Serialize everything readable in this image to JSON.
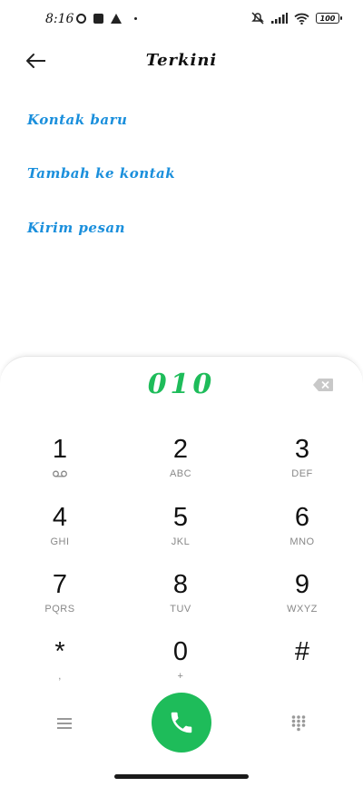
{
  "status_bar": {
    "time": "8:16",
    "battery": "100",
    "icons": [
      "circle-icon",
      "square-icon",
      "warning-icon",
      "dot-icon",
      "mute-icon",
      "signal-icon",
      "wifi-icon",
      "battery-icon"
    ]
  },
  "header": {
    "title": "Terkini",
    "back_icon": "arrow-left-icon"
  },
  "actions": [
    {
      "label": "Kontak baru"
    },
    {
      "label": "Tambah ke kontak"
    },
    {
      "label": "Kirim pesan"
    }
  ],
  "dialer": {
    "number": "010",
    "accent_color": "#1ebc5a",
    "keys": [
      {
        "digit": "1",
        "letters": "",
        "icon": "voicemail-icon"
      },
      {
        "digit": "2",
        "letters": "ABC"
      },
      {
        "digit": "3",
        "letters": "DEF"
      },
      {
        "digit": "4",
        "letters": "GHI"
      },
      {
        "digit": "5",
        "letters": "JKL"
      },
      {
        "digit": "6",
        "letters": "MNO"
      },
      {
        "digit": "7",
        "letters": "PQRS"
      },
      {
        "digit": "8",
        "letters": "TUV"
      },
      {
        "digit": "9",
        "letters": "WXYZ"
      },
      {
        "digit": "*",
        "letters": ","
      },
      {
        "digit": "0",
        "letters": "+"
      },
      {
        "digit": "#",
        "letters": ""
      }
    ]
  },
  "colors": {
    "link": "#1a8fdc",
    "call_green": "#1ebc5a"
  }
}
